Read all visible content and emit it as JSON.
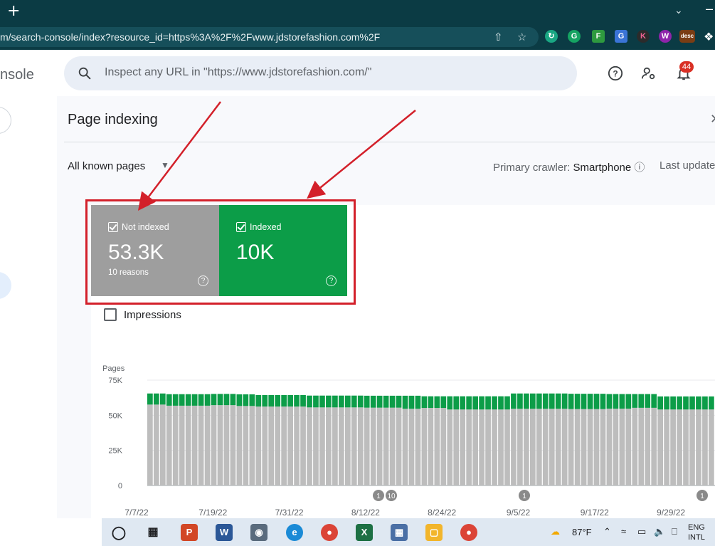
{
  "browser": {
    "url": "m/search-console/index?resource_id=https%3A%2F%2Fwww.jdstorefashion.com%2F",
    "extension_badges": [
      "K",
      "W",
      "desc"
    ]
  },
  "app": {
    "brand_fragment": "nsole",
    "search_placeholder": "Inspect any URL in \"https://www.jdstorefashion.com/\"",
    "notification_count": "44"
  },
  "page": {
    "title": "Page indexing",
    "filter_label": "All known pages",
    "crawler_label": "Primary crawler:",
    "crawler_value": "Smartphone",
    "last_update": "Last update"
  },
  "stats": {
    "not_indexed": {
      "label": "Not indexed",
      "value": "53.3K",
      "sub": "10 reasons",
      "color": "#9e9e9e"
    },
    "indexed": {
      "label": "Indexed",
      "value": "10K",
      "color": "#0c9d48"
    }
  },
  "impressions_label": "Impressions",
  "chart_data": {
    "type": "bar",
    "ylabel": "Pages",
    "ylim": [
      0,
      75000
    ],
    "yticks": [
      "0",
      "25K",
      "50K",
      "75K"
    ],
    "xtick_labels": [
      "7/7/22",
      "7/19/22",
      "7/31/22",
      "8/12/22",
      "8/24/22",
      "9/5/22",
      "9/17/22",
      "9/29/22"
    ],
    "annotations": [
      "1",
      "10",
      "1",
      "1"
    ],
    "series": [
      {
        "name": "Not indexed",
        "color": "#bdbdbd",
        "values": [
          57600,
          57600,
          57600,
          56800,
          56800,
          56800,
          56800,
          56800,
          56800,
          56800,
          57200,
          57200,
          57200,
          57200,
          56600,
          56600,
          56600,
          56200,
          56200,
          56200,
          56200,
          56200,
          56200,
          56200,
          56200,
          55600,
          55600,
          55600,
          55600,
          55600,
          55600,
          55600,
          55600,
          55600,
          55400,
          55400,
          55400,
          55400,
          55400,
          55400,
          54600,
          54600,
          54600,
          55200,
          55200,
          55200,
          55200,
          54100,
          54100,
          54100,
          54100,
          54100,
          54100,
          54100,
          54100,
          54100,
          54100,
          54600,
          54600,
          54600,
          54600,
          54600,
          54600,
          54600,
          54600,
          54600,
          54400,
          54400,
          54400,
          54400,
          54400,
          54400,
          54700,
          54700,
          54700,
          54700,
          55300,
          55300,
          55300,
          55300,
          54100,
          54100,
          54100,
          54100,
          54100,
          54100,
          54100,
          54100,
          54100
        ]
      },
      {
        "name": "Indexed",
        "color": "#0c9d48",
        "values": [
          7900,
          7900,
          7900,
          8200,
          8200,
          8200,
          8200,
          8200,
          8200,
          8200,
          8000,
          8000,
          8000,
          8000,
          8300,
          8300,
          8300,
          8200,
          8200,
          8200,
          8200,
          8200,
          8200,
          8200,
          8200,
          8400,
          8400,
          8400,
          8400,
          8400,
          8400,
          8400,
          8400,
          8400,
          8500,
          8500,
          8500,
          8500,
          8500,
          8500,
          9300,
          9300,
          9300,
          8300,
          8300,
          8300,
          8300,
          9400,
          9400,
          9400,
          9400,
          9400,
          9400,
          9400,
          9400,
          9400,
          9400,
          10900,
          10900,
          10900,
          10900,
          10900,
          10900,
          10900,
          10900,
          10900,
          10900,
          10900,
          10900,
          10900,
          10900,
          10900,
          10400,
          10400,
          10400,
          10400,
          9800,
          9800,
          9800,
          9800,
          9300,
          9300,
          9300,
          9300,
          9300,
          9300,
          9300,
          9300,
          9300
        ]
      }
    ]
  },
  "taskbar": {
    "temperature": "87°F",
    "lang_line1": "ENG",
    "lang_line2": "INTL"
  }
}
